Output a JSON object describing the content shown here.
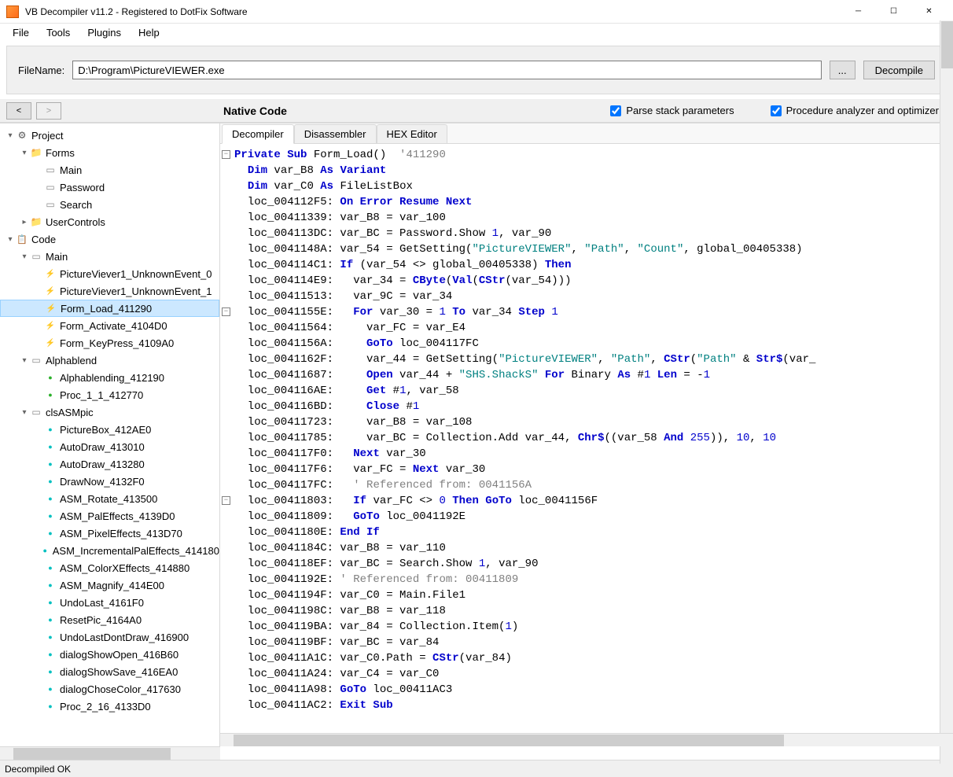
{
  "window": {
    "title": "VB Decompiler v11.2 - Registered to DotFix Software"
  },
  "menubar": [
    "File",
    "Tools",
    "Plugins",
    "Help"
  ],
  "filebar": {
    "label": "FileName:",
    "path": "D:\\Program\\PictureVIEWER.exe",
    "browse": "...",
    "decompile": "Decompile"
  },
  "toolbar": {
    "back": "<",
    "fwd": ">",
    "section": "Native Code",
    "chk1": "Parse stack parameters",
    "chk2": "Procedure analyzer and optimizer"
  },
  "tree": [
    {
      "d": 0,
      "t": "project",
      "tw": "▾",
      "txt": "Project"
    },
    {
      "d": 1,
      "t": "folder",
      "tw": "▾",
      "txt": "Forms"
    },
    {
      "d": 2,
      "t": "form",
      "tw": "",
      "txt": "Main"
    },
    {
      "d": 2,
      "t": "form",
      "tw": "",
      "txt": "Password"
    },
    {
      "d": 2,
      "t": "form",
      "tw": "",
      "txt": "Search"
    },
    {
      "d": 1,
      "t": "folder",
      "tw": "▸",
      "txt": "UserControls"
    },
    {
      "d": 0,
      "t": "code",
      "tw": "▾",
      "txt": "Code"
    },
    {
      "d": 1,
      "t": "module",
      "tw": "▾",
      "txt": "Main"
    },
    {
      "d": 2,
      "t": "meth-y",
      "tw": "",
      "txt": "PictureViever1_UnknownEvent_0"
    },
    {
      "d": 2,
      "t": "meth-y",
      "tw": "",
      "txt": "PictureViever1_UnknownEvent_1"
    },
    {
      "d": 2,
      "t": "meth-y",
      "tw": "",
      "txt": "Form_Load_411290",
      "sel": true
    },
    {
      "d": 2,
      "t": "meth-y",
      "tw": "",
      "txt": "Form_Activate_4104D0"
    },
    {
      "d": 2,
      "t": "meth-y",
      "tw": "",
      "txt": "Form_KeyPress_4109A0"
    },
    {
      "d": 1,
      "t": "module",
      "tw": "▾",
      "txt": "Alphablend"
    },
    {
      "d": 2,
      "t": "meth-g",
      "tw": "",
      "txt": "Alphablending_412190"
    },
    {
      "d": 2,
      "t": "meth-g",
      "tw": "",
      "txt": "Proc_1_1_412770"
    },
    {
      "d": 1,
      "t": "module",
      "tw": "▾",
      "txt": "clsASMpic"
    },
    {
      "d": 2,
      "t": "meth-c",
      "tw": "",
      "txt": "PictureBox_412AE0"
    },
    {
      "d": 2,
      "t": "meth-c",
      "tw": "",
      "txt": "AutoDraw_413010"
    },
    {
      "d": 2,
      "t": "meth-c",
      "tw": "",
      "txt": "AutoDraw_413280"
    },
    {
      "d": 2,
      "t": "meth-c",
      "tw": "",
      "txt": "DrawNow_4132F0"
    },
    {
      "d": 2,
      "t": "meth-c",
      "tw": "",
      "txt": "ASM_Rotate_413500"
    },
    {
      "d": 2,
      "t": "meth-c",
      "tw": "",
      "txt": "ASM_PalEffects_4139D0"
    },
    {
      "d": 2,
      "t": "meth-c",
      "tw": "",
      "txt": "ASM_PixelEffects_413D70"
    },
    {
      "d": 2,
      "t": "meth-c",
      "tw": "",
      "txt": "ASM_IncrementalPalEffects_414180"
    },
    {
      "d": 2,
      "t": "meth-c",
      "tw": "",
      "txt": "ASM_ColorXEffects_414880"
    },
    {
      "d": 2,
      "t": "meth-c",
      "tw": "",
      "txt": "ASM_Magnify_414E00"
    },
    {
      "d": 2,
      "t": "meth-c",
      "tw": "",
      "txt": "UndoLast_4161F0"
    },
    {
      "d": 2,
      "t": "meth-c",
      "tw": "",
      "txt": "ResetPic_4164A0"
    },
    {
      "d": 2,
      "t": "meth-c",
      "tw": "",
      "txt": "UndoLastDontDraw_416900"
    },
    {
      "d": 2,
      "t": "meth-c",
      "tw": "",
      "txt": "dialogShowOpen_416B60"
    },
    {
      "d": 2,
      "t": "meth-c",
      "tw": "",
      "txt": "dialogShowSave_416EA0"
    },
    {
      "d": 2,
      "t": "meth-c",
      "tw": "",
      "txt": "dialogChoseColor_417630"
    },
    {
      "d": 2,
      "t": "meth-c",
      "tw": "",
      "txt": "Proc_2_16_4133D0"
    }
  ],
  "tabs": [
    "Decompiler",
    "Disassembler",
    "HEX Editor"
  ],
  "code_lines": [
    {
      "fold": "-",
      "html": "<span class='kw'>Private Sub</span> Form_Load()  <span class='cmt'>'411290</span>"
    },
    {
      "html": "  <span class='kw'>Dim</span> var_B8 <span class='kw'>As Variant</span>"
    },
    {
      "html": "  <span class='kw'>Dim</span> var_C0 <span class='kw'>As</span> FileListBox"
    },
    {
      "html": "  loc_004112F5: <span class='kw'>On Error Resume Next</span>"
    },
    {
      "html": "  loc_00411339: var_B8 = var_100"
    },
    {
      "html": "  loc_004113DC: var_BC = Password.Show <span class='num'>1</span>, var_90"
    },
    {
      "html": "  loc_0041148A: var_54 = GetSetting(<span class='str'>\"PictureVIEWER\"</span>, <span class='str'>\"Path\"</span>, <span class='str'>\"Count\"</span>, global_00405338)"
    },
    {
      "html": "  loc_004114C1: <span class='kw'>If</span> (var_54 &lt;&gt; global_00405338) <span class='kw'>Then</span>"
    },
    {
      "html": "  loc_004114E9:   var_34 = <span class='kw'>CByte</span>(<span class='kw'>Val</span>(<span class='kw'>CStr</span>(var_54)))"
    },
    {
      "html": "  loc_00411513:   var_9C = var_34"
    },
    {
      "fold": "-",
      "html": "  loc_0041155E:   <span class='kw'>For</span> var_30 = <span class='num'>1</span> <span class='kw'>To</span> var_34 <span class='kw'>Step</span> <span class='num'>1</span>"
    },
    {
      "html": "  loc_00411564:     var_FC = var_E4"
    },
    {
      "html": "  loc_0041156A:     <span class='kw'>GoTo</span> loc_004117FC"
    },
    {
      "html": "  loc_0041162F:     var_44 = GetSetting(<span class='str'>\"PictureVIEWER\"</span>, <span class='str'>\"Path\"</span>, <span class='kw'>CStr</span>(<span class='str'>\"Path\"</span> &amp; <span class='kw'>Str$</span>(var_"
    },
    {
      "html": "  loc_00411687:     <span class='kw'>Open</span> var_44 + <span class='str'>\"SHS.ShackS\"</span> <span class='kw'>For</span> Binary <span class='kw'>As</span> #<span class='num'>1</span> <span class='kw'>Len</span> = -<span class='num'>1</span>"
    },
    {
      "html": "  loc_004116AE:     <span class='kw'>Get</span> #<span class='num'>1</span>, var_58"
    },
    {
      "html": "  loc_004116BD:     <span class='kw'>Close</span> #<span class='num'>1</span>"
    },
    {
      "html": "  loc_00411723:     var_B8 = var_108"
    },
    {
      "html": "  loc_00411785:     var_BC = Collection.Add var_44, <span class='kw'>Chr$</span>((var_58 <span class='kw'>And</span> <span class='num'>255</span>)), <span class='num'>10</span>, <span class='num'>10</span>"
    },
    {
      "html": "  loc_004117F0:   <span class='kw'>Next</span> var_30"
    },
    {
      "html": "  loc_004117F6:   var_FC = <span class='kw'>Next</span> var_30"
    },
    {
      "html": "  loc_004117FC:   <span class='cmt'>' Referenced from: 0041156A</span>"
    },
    {
      "fold": "-",
      "html": "  loc_00411803:   <span class='kw'>If</span> var_FC &lt;&gt; <span class='num'>0</span> <span class='kw'>Then GoTo</span> loc_0041156F"
    },
    {
      "html": "  loc_00411809:   <span class='kw'>GoTo</span> loc_0041192E"
    },
    {
      "html": "  loc_0041180E: <span class='kw'>End If</span>"
    },
    {
      "html": "  loc_0041184C: var_B8 = var_110"
    },
    {
      "html": "  loc_004118EF: var_BC = Search.Show <span class='num'>1</span>, var_90"
    },
    {
      "html": "  loc_0041192E: <span class='cmt'>' Referenced from: 00411809</span>"
    },
    {
      "html": "  loc_0041194F: var_C0 = Main.File1"
    },
    {
      "html": "  loc_0041198C: var_B8 = var_118"
    },
    {
      "html": "  loc_004119BA: var_84 = Collection.Item(<span class='num'>1</span>)"
    },
    {
      "html": "  loc_004119BF: var_BC = var_84"
    },
    {
      "html": "  loc_00411A1C: var_C0.Path = <span class='kw'>CStr</span>(var_84)"
    },
    {
      "html": "  loc_00411A24: var_C4 = var_C0"
    },
    {
      "html": "  loc_00411A98: <span class='kw'>GoTo</span> loc_00411AC3"
    },
    {
      "html": "  loc_00411AC2: <span class='kw'>Exit Sub</span>"
    }
  ],
  "status": "Decompiled OK"
}
